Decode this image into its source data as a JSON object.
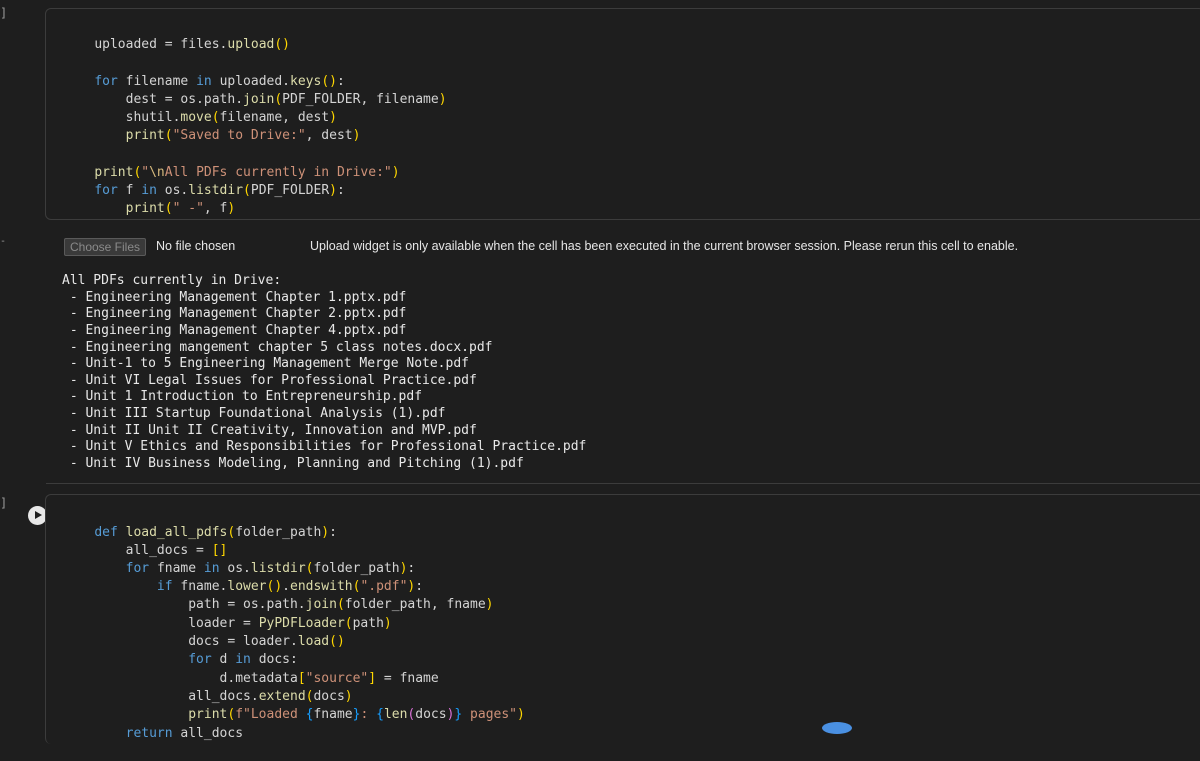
{
  "gutter": {
    "mark_top": "]",
    "mark_mid": "-",
    "mark_bottom": "]"
  },
  "cell1": {
    "lines": [
      "uploaded = files.upload()",
      "",
      "for filename in uploaded.keys():",
      "    dest = os.path.join(PDF_FOLDER, filename)",
      "    shutil.move(filename, dest)",
      "    print(\"Saved to Drive:\", dest)",
      "",
      "print(\"\\nAll PDFs currently in Drive:\")",
      "for f in os.listdir(PDF_FOLDER):",
      "    print(\" -\", f)"
    ]
  },
  "output": {
    "choose_files_label": "Choose Files",
    "no_file_label": "No file chosen",
    "upload_message": "Upload widget is only available when the cell has been executed in the current browser session. Please rerun this cell to enable.",
    "lines": [
      "All PDFs currently in Drive:",
      " - Engineering Management Chapter 1.pptx.pdf",
      " - Engineering Management Chapter 2.pptx.pdf",
      " - Engineering Management Chapter 4.pptx.pdf",
      " - Engineering mangement chapter 5 class notes.docx.pdf",
      " - Unit-1 to 5 Engineering Management Merge Note.pdf",
      " - Unit VI Legal Issues for Professional Practice.pdf",
      " - Unit 1 Introduction to Entrepreneurship.pdf",
      " - Unit III Startup Foundational Analysis (1).pdf",
      " - Unit II Unit II Creativity, Innovation and MVP.pdf",
      " - Unit V Ethics and Responsibilities for Professional Practice.pdf",
      " - Unit IV Business Modeling, Planning and Pitching (1).pdf"
    ]
  },
  "cell2": {
    "lines": [
      "def load_all_pdfs(folder_path):",
      "    all_docs = []",
      "    for fname in os.listdir(folder_path):",
      "        if fname.lower().endswith(\".pdf\"):",
      "            path = os.path.join(folder_path, fname)",
      "            loader = PyPDFLoader(path)",
      "            docs = loader.load()",
      "            for d in docs:",
      "                d.metadata[\"source\"] = fname",
      "            all_docs.extend(docs)",
      "            print(f\"Loaded {fname}: {len(docs)} pages\")",
      "    return all_docs"
    ]
  },
  "colors": {
    "background": "#1e1e1e",
    "keyword": "#569cd6",
    "function": "#dcdcaa",
    "string": "#ce9178",
    "bracket": "#ffd700"
  }
}
